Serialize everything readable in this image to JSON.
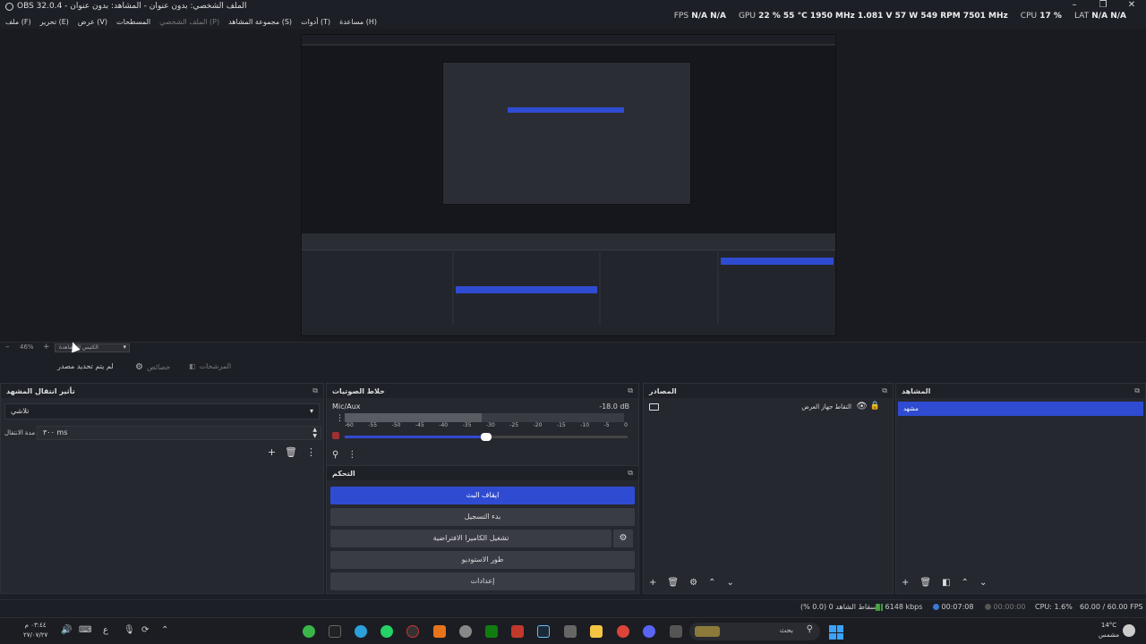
{
  "window": {
    "title": "OBS 32.0.4 - الملف الشخصي: بدون عنوان - المشاهد: بدون عنوان",
    "controls": [
      "–",
      "❐",
      "✕"
    ]
  },
  "menu": [
    "ملف (F)",
    "تحرير (E)",
    "عرض (V)",
    "المسطحات",
    "الملف الشخصي (P)",
    "مجموعة المشاهد (S)",
    "أدوات (T)",
    "مساعدة (H)"
  ],
  "stats": {
    "fps_label": "FPS",
    "fps_a": "N/A",
    "fps_b": "N/A",
    "gpu_label": "GPU",
    "gpu_util": "22 %",
    "gpu_temp": "55 °C",
    "gpu_clock": "1950 MHz",
    "gpu_volt": "1.081 V",
    "gpu_power": "57 W",
    "gpu_fan": "549 RPM",
    "gpu_mem": "7501 MHz",
    "cpu_label": "CPU",
    "cpu_util": "17 %",
    "lat_label": "LAT",
    "lat_a": "N/A",
    "lat_b": "N/A"
  },
  "preview_toolbar": {
    "zoom": "46%",
    "zoom_minus": "–",
    "zoom_plus": "+",
    "mode": "الكثيس للمشاهدة"
  },
  "context": {
    "source_none": "لم يتم تحديد مصدر",
    "properties": "خصائص",
    "filters": "المرشحات"
  },
  "transitions": {
    "title": "تأثير انتقال المشهد",
    "type": "تلاشي",
    "duration_label": "مدة الانتقال",
    "duration_value": "٣٠٠ ms"
  },
  "mixer": {
    "title": "خلاط الصوتيات",
    "channel": "Mic/Aux",
    "level": "-18.0 dB",
    "level_fraction": 0.49,
    "ticks": [
      "-60",
      "-55",
      "-50",
      "-45",
      "-40",
      "-35",
      "-30",
      "-25",
      "-20",
      "-15",
      "-10",
      "-5",
      "0"
    ],
    "fader_fraction": 0.5
  },
  "controls": {
    "title": "التحكم",
    "stop_stream": "ايقاف البث",
    "start_record": "بدء التسجيل",
    "virtual_cam": "تشغيل الكاميرا الافتراضية",
    "studio_mode": "طور الاستوديو",
    "settings": "إعدادات"
  },
  "sources": {
    "title": "المصادر",
    "item": "التقاط جهاز العرض"
  },
  "scenes": {
    "title": "المشاهد",
    "item": "مشهد"
  },
  "status": {
    "dropped": "إسقاط الشاهد 0 (0.0 %)",
    "bitrate": "6148 kbps",
    "stream_time": "00:07:08",
    "rec_time": "00:00:00",
    "cpu": "CPU: 1.6%",
    "fps": "60.00 / 60.00 FPS"
  },
  "taskbar": {
    "search": "بحث",
    "clock_time": "٠٣:٤٤ م",
    "clock_date": "٢٧/٠٧/٢٧",
    "weather_temp": "14°C",
    "weather_desc": "مشمس",
    "lang": "ع"
  },
  "colors": {
    "accent": "#2f4bd1",
    "panel": "#262830",
    "background": "#1d1f26"
  }
}
